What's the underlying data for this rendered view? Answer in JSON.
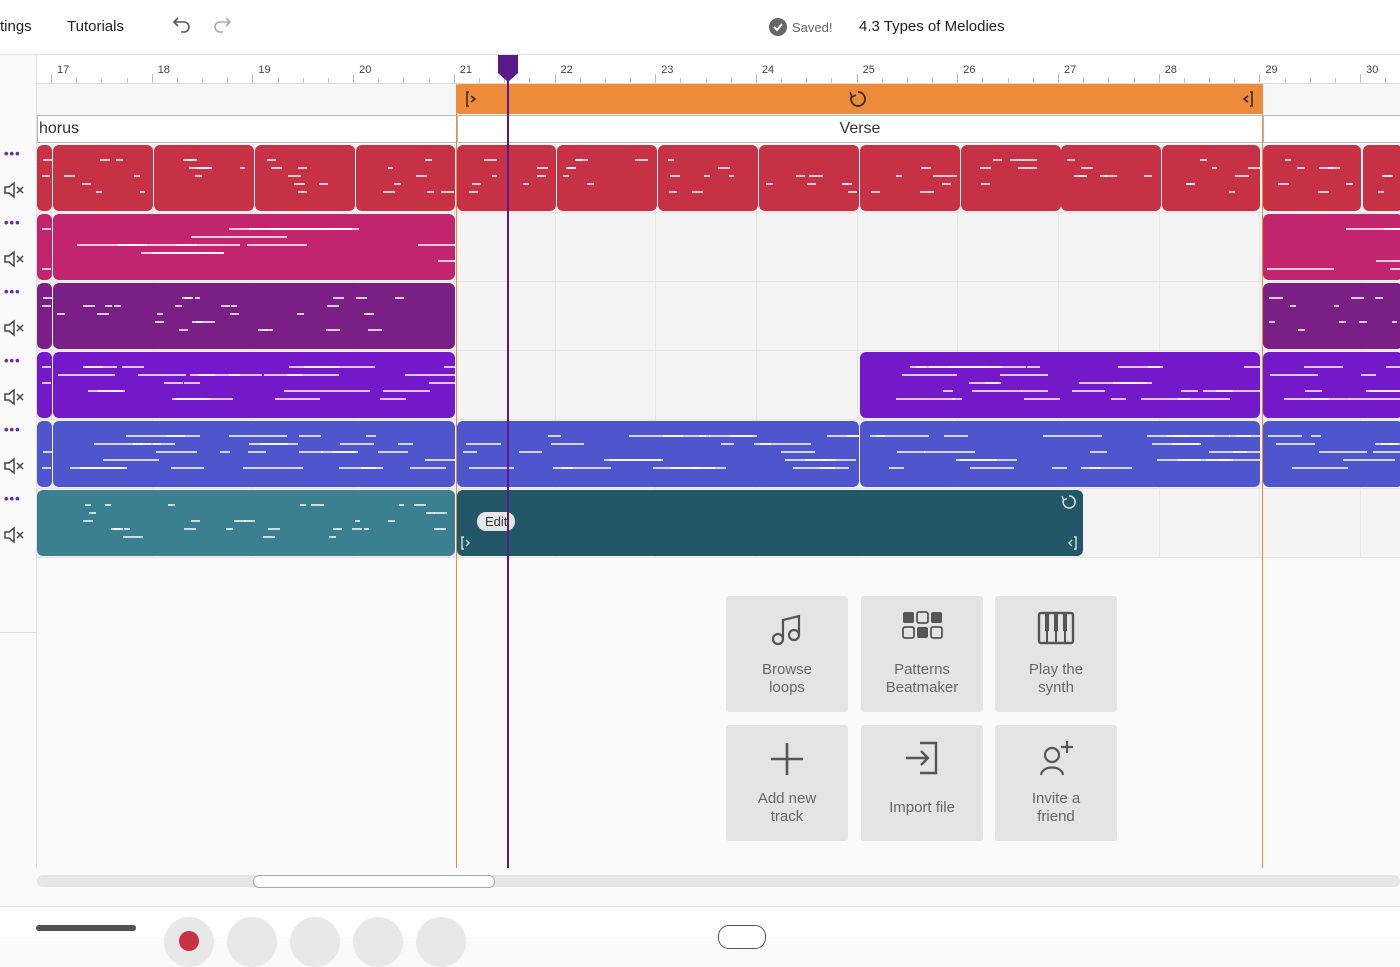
{
  "topbar": {
    "settings_label": "tings",
    "tutorials_label": "Tutorials",
    "saved_label": "Saved!",
    "project_title": "4.3 Types of Melodies",
    "icons": [
      "undo-icon",
      "redo-icon",
      "check-circle-icon"
    ]
  },
  "ruler": {
    "bars": [
      "17",
      "18",
      "19",
      "20",
      "21",
      "22",
      "23",
      "24",
      "25",
      "26",
      "27",
      "28",
      "29",
      "30"
    ]
  },
  "sections": [
    {
      "label": "horus"
    },
    {
      "label": "Verse"
    },
    {
      "label": ""
    }
  ],
  "tracks": [
    {
      "color": "#c63145"
    },
    {
      "color": "#c2246e"
    },
    {
      "color": "#7a1f86"
    },
    {
      "color": "#7419c9"
    },
    {
      "color": "#4f56cd"
    },
    {
      "color": "#3a8090"
    }
  ],
  "selected_clip": {
    "edit_label": "Edit",
    "color": "#215767"
  },
  "tiles": [
    {
      "line1": "Browse",
      "line2": "loops"
    },
    {
      "line1": "Patterns",
      "line2": "Beatmaker"
    },
    {
      "line1": "Play the",
      "line2": "synth"
    },
    {
      "line1": "Add new",
      "line2": "track"
    },
    {
      "line1": "Import file",
      "line2": ""
    },
    {
      "line1": "Invite a",
      "line2": "friend"
    }
  ],
  "colors": {
    "loop": "#ee8b3a",
    "playhead": "#5a1a8a",
    "accent": "#6a2aa8"
  }
}
